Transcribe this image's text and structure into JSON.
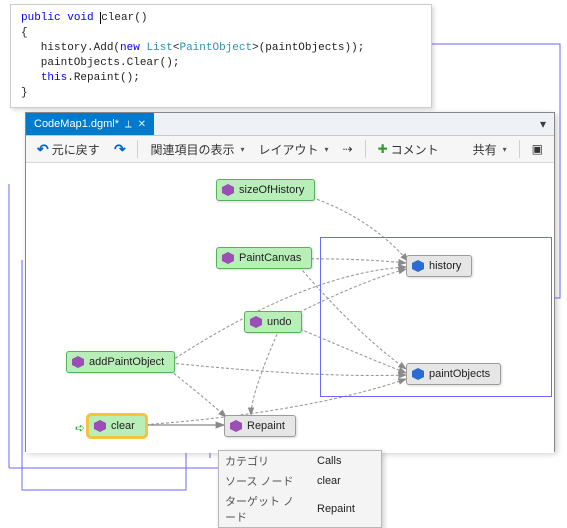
{
  "code": {
    "line1_kw1": "public",
    "line1_kw2": "void",
    "line1_name": "clear()",
    "brace_open": "{",
    "line3a": "   history.Add(",
    "line3_kw": "new",
    "line3b": " ",
    "line3_type": "List",
    "line3c": "<",
    "line3_type2": "PaintObject",
    "line3d": ">(paintObjects));",
    "line4": "   paintObjects.Clear();",
    "line5_kw": "this",
    "line5_rest": ".Repaint();",
    "brace_close": "}"
  },
  "window": {
    "tab_title": "CodeMap1.dgml*",
    "toolbar": {
      "undo_label": "元に戻す",
      "related_label": "関連項目の表示",
      "layout_label": "レイアウト",
      "comment_label": "コメント",
      "share_label": "共有"
    }
  },
  "nodes": {
    "sizeOfHistory": "sizeOfHistory",
    "history": "history",
    "PaintCanvas": "PaintCanvas",
    "undo": "undo",
    "addPaintObject": "addPaintObject",
    "paintObjects": "paintObjects",
    "clear": "clear",
    "Repaint": "Repaint"
  },
  "tooltip": {
    "k1": "カテゴリ",
    "v1": "Calls",
    "k2": "ソース ノード",
    "v2": "clear",
    "k3": "ターゲット ノード",
    "v3": "Repaint"
  }
}
